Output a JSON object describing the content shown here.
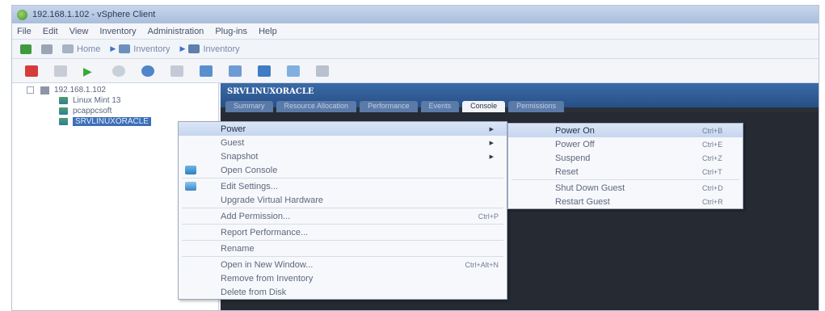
{
  "window": {
    "title": "192.168.1.102 - vSphere Client"
  },
  "menubar": [
    "File",
    "Edit",
    "View",
    "Inventory",
    "Administration",
    "Plug-ins",
    "Help"
  ],
  "navbar": {
    "home": "Home",
    "crumbs": [
      "Inventory",
      "Inventory"
    ]
  },
  "tree": {
    "host": "192.168.1.102",
    "vms": [
      "Linux Mint 13",
      "pcappcsoft",
      "SRVLINUXORACLE"
    ]
  },
  "vm": {
    "name": "SRVLINUXORACLE",
    "tabs": [
      "Summary",
      "Resource Allocation",
      "Performance",
      "Events",
      "Console",
      "Permissions"
    ],
    "active_tab": "Console"
  },
  "context_menu": {
    "items": [
      {
        "label": "Power",
        "submenu": true
      },
      {
        "label": "Guest",
        "submenu": true
      },
      {
        "label": "Snapshot",
        "submenu": true
      },
      {
        "label": "Open Console"
      },
      {
        "label": "Edit Settings..."
      },
      {
        "label": "Upgrade Virtual Hardware"
      },
      {
        "label": "Add Permission...",
        "shortcut": "Ctrl+P"
      },
      {
        "label": "Report Performance..."
      },
      {
        "label": "Rename"
      },
      {
        "label": "Open in New Window...",
        "shortcut": "Ctrl+Alt+N"
      },
      {
        "label": "Remove from Inventory"
      },
      {
        "label": "Delete from Disk"
      }
    ]
  },
  "power_menu": {
    "items": [
      {
        "label": "Power On",
        "shortcut": "Ctrl+B"
      },
      {
        "label": "Power Off",
        "shortcut": "Ctrl+E"
      },
      {
        "label": "Suspend",
        "shortcut": "Ctrl+Z"
      },
      {
        "label": "Reset",
        "shortcut": "Ctrl+T"
      },
      {
        "label": "Shut Down Guest",
        "shortcut": "Ctrl+D"
      },
      {
        "label": "Restart Guest",
        "shortcut": "Ctrl+R"
      }
    ]
  },
  "colors": {
    "accent": "#3d6fb8",
    "header": "#284f86",
    "console": "#262b33"
  }
}
